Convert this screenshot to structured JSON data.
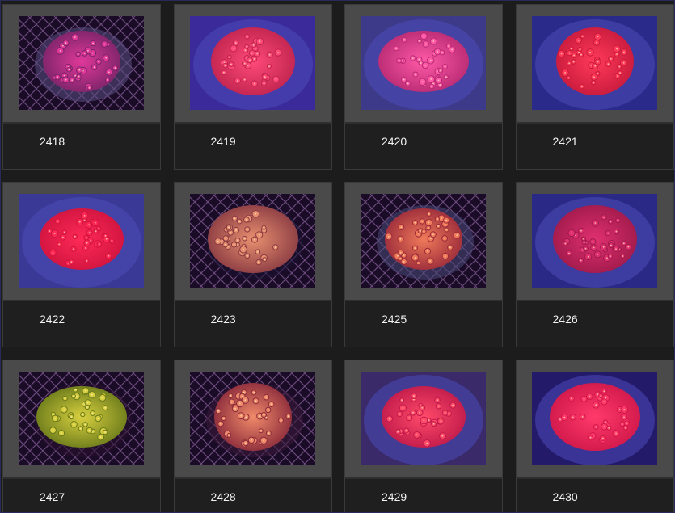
{
  "gallery": {
    "items": [
      {
        "label": "2418",
        "tint": "#7a2468",
        "glow": "#e0389a",
        "bg": "#5a4c82",
        "mesh": true
      },
      {
        "label": "2419",
        "tint": "#c0244e",
        "glow": "#ff4a7a",
        "bg": "#3a2a9a",
        "mesh": false
      },
      {
        "label": "2420",
        "tint": "#b82a72",
        "glow": "#ff5aa8",
        "bg": "#3e3a8a",
        "mesh": false
      },
      {
        "label": "2421",
        "tint": "#c81a3c",
        "glow": "#ff3a5a",
        "bg": "#2a2a8a",
        "mesh": false
      },
      {
        "label": "2422",
        "tint": "#d0143e",
        "glow": "#ff2a58",
        "bg": "#3a3a96",
        "mesh": false
      },
      {
        "label": "2423",
        "tint": "#8a3a42",
        "glow": "#e89070",
        "bg": "#1a1030",
        "mesh": true
      },
      {
        "label": "2425",
        "tint": "#9a2a3a",
        "glow": "#f07a5a",
        "bg": "#4a4a7a",
        "mesh": true
      },
      {
        "label": "2426",
        "tint": "#a01a4a",
        "glow": "#e03070",
        "bg": "#2a2a86",
        "mesh": false
      },
      {
        "label": "2427",
        "tint": "#6a7a1a",
        "glow": "#d8d040",
        "bg": "#2a1030",
        "mesh": true
      },
      {
        "label": "2428",
        "tint": "#8a2a3a",
        "glow": "#f08a6a",
        "bg": "#3a1a3a",
        "mesh": true
      },
      {
        "label": "2429",
        "tint": "#c01a4a",
        "glow": "#ff4a6a",
        "bg": "#3a2a6a",
        "mesh": false
      },
      {
        "label": "2430",
        "tint": "#d0184a",
        "glow": "#ff3a6a",
        "bg": "#241a6a",
        "mesh": false
      }
    ]
  }
}
